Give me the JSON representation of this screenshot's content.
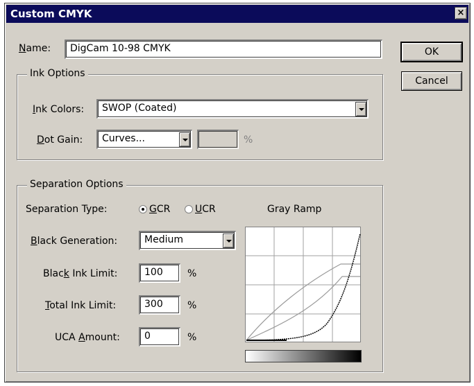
{
  "window": {
    "title": "Custom CMYK",
    "close_glyph": "×"
  },
  "name_field": {
    "label_prefix": "N",
    "label_rest": "ame:",
    "value": "DigCam 10-98 CMYK"
  },
  "buttons": {
    "ok": "OK",
    "cancel": "Cancel"
  },
  "ink_options": {
    "title": "Ink Options",
    "ink_colors": {
      "label_u": "I",
      "label_rest": "nk Colors:",
      "value": "SWOP (Coated)"
    },
    "dot_gain": {
      "label_u": "D",
      "label_rest": "ot Gain:",
      "value": "Curves...",
      "percent_value": "",
      "unit": "%"
    }
  },
  "separation_options": {
    "title": "Separation Options",
    "separation_type": {
      "label": "Separation Type:",
      "gcr_u": "G",
      "gcr_rest": "CR",
      "ucr_u": "U",
      "ucr_rest": "CR",
      "selected": "GCR"
    },
    "black_generation": {
      "label_pre": "",
      "label_u": "B",
      "label_rest": "lack Generation:",
      "value": "Medium"
    },
    "black_ink_limit": {
      "label_pre": "Blac",
      "label_u": "k",
      "label_rest": " Ink Limit:",
      "value": "100",
      "unit": "%"
    },
    "total_ink_limit": {
      "label_pre": "",
      "label_u": "T",
      "label_rest": "otal Ink Limit:",
      "value": "300",
      "unit": "%"
    },
    "uca_amount": {
      "label_pre": "UCA ",
      "label_u": "A",
      "label_rest": "mount:",
      "value": "0",
      "unit": "%"
    }
  },
  "gray_ramp": {
    "title": "Gray Ramp"
  },
  "colors": {
    "title_bar": "#0b0b5a",
    "dialog_bg": "#d4d0c8"
  }
}
